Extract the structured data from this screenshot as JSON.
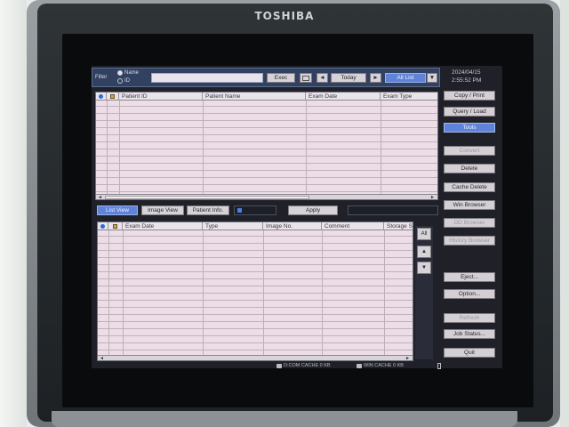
{
  "device": {
    "brand": "TOSHIBA"
  },
  "datetime": {
    "date": "2024/04/15",
    "time": "2:55:52 PM"
  },
  "filter": {
    "label": "Filter",
    "radio_options": [
      {
        "label": "Name",
        "selected": true
      },
      {
        "label": "ID",
        "selected": false
      }
    ],
    "input_value": "",
    "exec_label": "Exec",
    "prev_label": "◄",
    "today_label": "Today",
    "next_label": "►",
    "list_label": "All List",
    "dropdown_label": "▼"
  },
  "upper_table": {
    "columns": [
      "Patient ID",
      "Patient Name",
      "Exam Date",
      "Exam Type"
    ],
    "rows": []
  },
  "view_tabs": {
    "list_view": "List View",
    "image_view": "Image View",
    "patient_info": "Patient Info.",
    "apply": "Apply"
  },
  "lower_table": {
    "columns": [
      "Exam Date",
      "Type",
      "Image No.",
      "Comment",
      "Storage S"
    ],
    "rows": []
  },
  "nav": {
    "all": "All",
    "up": "▲",
    "down": "▼"
  },
  "side_buttons": {
    "copy_print": "Copy / Print",
    "query_load": "Query / Load",
    "tools": "Tools",
    "convert": "Convert",
    "delete": "Delete",
    "cache_delete": "Cache Delete",
    "win_browser": "Win Browser",
    "dd_browser": "DD Browser",
    "history_browser": "History Browser",
    "eject": "Eject...",
    "option": "Option...",
    "refresh": "Refresh",
    "job_status": "Job Status...",
    "quit": "Quit"
  },
  "status": {
    "d_cache": "D:COM CACHE 0 KB",
    "win_cache": "WIN CACHE 0 KB"
  },
  "colors": {
    "table_bg": "#ecdde7",
    "active_blue": "#5f83d9",
    "panel_dark": "#1f2028"
  }
}
